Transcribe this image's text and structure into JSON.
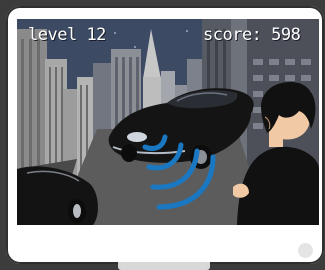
{
  "hud": {
    "level_label": "level",
    "level_value": "12",
    "score_label": "score:",
    "score_value": "598"
  },
  "scene": {
    "sky_color": "#3c4a63",
    "building_colors": [
      "#7b7b7b",
      "#9a9a9a",
      "#b0b0b0",
      "#5e6470"
    ],
    "road_color": "#5c5c5c",
    "car_color": "#111111",
    "signal_color": "#1a78c2",
    "character_hair_color": "#111111",
    "character_skin_color": "#f1c9a5",
    "character_shirt_color": "#111111"
  },
  "icons": [
    "signal-waves-icon"
  ]
}
